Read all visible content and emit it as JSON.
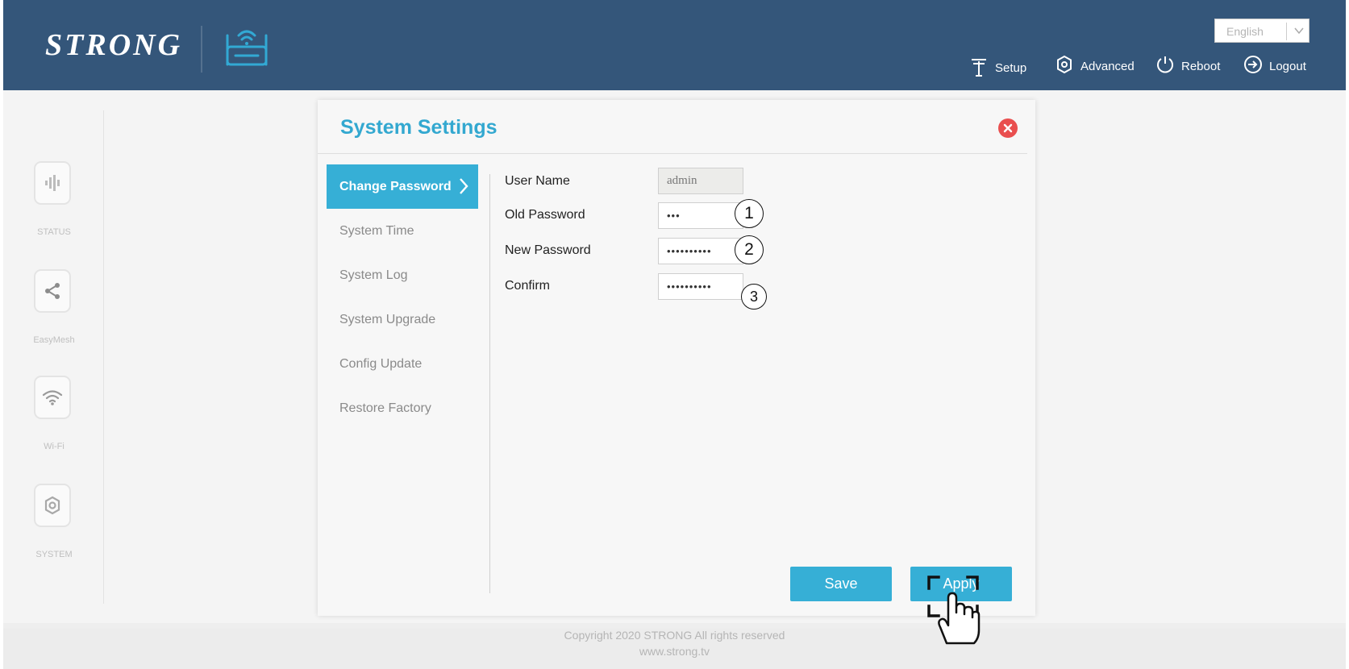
{
  "header": {
    "logo_text": "STRONG",
    "language": {
      "selected": "English"
    },
    "nav": [
      {
        "label": "Setup",
        "icon": "antenna-icon"
      },
      {
        "label": "Advanced",
        "icon": "gear-icon"
      },
      {
        "label": "Reboot",
        "icon": "power-icon"
      },
      {
        "label": "Logout",
        "icon": "logout-icon"
      }
    ]
  },
  "sidebar": {
    "items": [
      {
        "label": "STATUS",
        "icon": "status-icon"
      },
      {
        "label": "EasyMesh",
        "icon": "share-icon"
      },
      {
        "label": "Wi-Fi",
        "icon": "wifi-icon"
      },
      {
        "label": "SYSTEM",
        "icon": "gear-icon"
      }
    ]
  },
  "dialog": {
    "title": "System Settings",
    "menu": [
      "Change Password",
      "System Time",
      "System Log",
      "System Upgrade",
      "Config Update",
      "Restore Factory"
    ],
    "active_menu": "Change Password",
    "form": {
      "username_label": "User Name",
      "username_value": "admin",
      "old_password_label": "Old Password",
      "old_password_value": "•••",
      "new_password_label": "New Password",
      "new_password_value": "••••••••••",
      "confirm_label": "Confirm",
      "confirm_value": "••••••••••"
    },
    "callouts": [
      "1",
      "2",
      "3"
    ],
    "save_label": "Save",
    "apply_label": "Apply"
  },
  "footer": {
    "copyright": "Copyright 2020 STRONG All rights reserved",
    "website": "www.strong.tv"
  },
  "colors": {
    "header_bg": "#34567a",
    "accent": "#36afd6",
    "title": "#33a8d0",
    "close": "#e94f4f"
  }
}
